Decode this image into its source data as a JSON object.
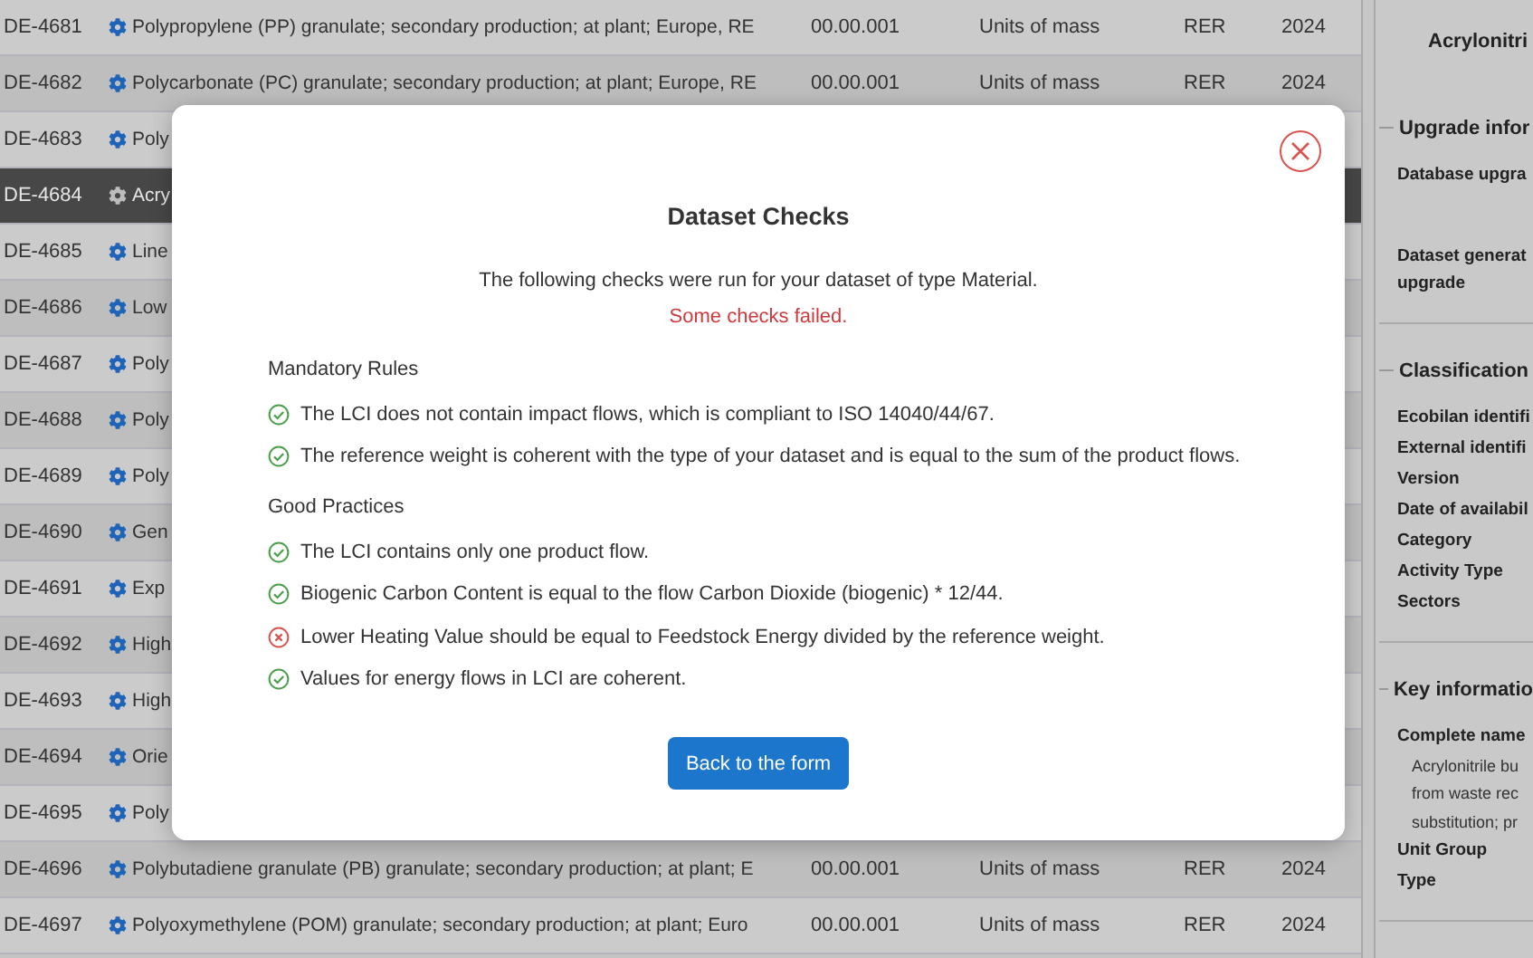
{
  "table": {
    "rows": [
      {
        "id": "DE-4681",
        "name": "Polypropylene (PP) granulate; secondary production; at plant; Europe, RE",
        "version": "00.00.001",
        "unit": "Units of mass",
        "location": "RER",
        "year": "2024",
        "selected": false
      },
      {
        "id": "DE-4682",
        "name": "Polycarbonate (PC) granulate; secondary production; at plant; Europe, RE",
        "version": "00.00.001",
        "unit": "Units of mass",
        "location": "RER",
        "year": "2024",
        "selected": false
      },
      {
        "id": "DE-4683",
        "name": "Poly",
        "selected": false
      },
      {
        "id": "DE-4684",
        "name": "Acry",
        "selected": true
      },
      {
        "id": "DE-4685",
        "name": "Line",
        "selected": false
      },
      {
        "id": "DE-4686",
        "name": "Low",
        "selected": false
      },
      {
        "id": "DE-4687",
        "name": "Poly",
        "selected": false
      },
      {
        "id": "DE-4688",
        "name": "Poly",
        "selected": false
      },
      {
        "id": "DE-4689",
        "name": "Poly",
        "selected": false
      },
      {
        "id": "DE-4690",
        "name": "Gen",
        "selected": false
      },
      {
        "id": "DE-4691",
        "name": "Exp",
        "selected": false
      },
      {
        "id": "DE-4692",
        "name": "High",
        "selected": false
      },
      {
        "id": "DE-4693",
        "name": "High",
        "selected": false
      },
      {
        "id": "DE-4694",
        "name": "Orie",
        "selected": false
      },
      {
        "id": "DE-4695",
        "name": "Poly",
        "selected": false
      },
      {
        "id": "DE-4696",
        "name": "Polybutadiene granulate (PB) granulate; secondary production; at plant; E",
        "version": "00.00.001",
        "unit": "Units of mass",
        "location": "RER",
        "year": "2024",
        "selected": false
      },
      {
        "id": "DE-4697",
        "name": "Polyoxymethylene (POM) granulate; secondary production; at plant; Euro",
        "version": "00.00.001",
        "unit": "Units of mass",
        "location": "RER",
        "year": "2024",
        "selected": false
      }
    ]
  },
  "detail_panel": {
    "title": "Acrylonitri",
    "sections": [
      {
        "legend": "Upgrade infor",
        "fields": [
          {
            "label": [
              "Database upgra"
            ]
          },
          {
            "label": [
              "Dataset generat",
              "upgrade"
            ]
          }
        ]
      },
      {
        "legend": "Classification",
        "fields": [
          {
            "label": [
              "Ecobilan identifi"
            ]
          },
          {
            "label": [
              "External identifi"
            ]
          },
          {
            "label": [
              "Version"
            ]
          },
          {
            "label": [
              "Date of availabil"
            ]
          },
          {
            "label": [
              "Category"
            ]
          },
          {
            "label": [
              "Activity Type"
            ]
          },
          {
            "label": [
              "Sectors"
            ]
          }
        ]
      },
      {
        "legend": "Key informatio",
        "fields": [
          {
            "label": [
              "Complete name"
            ],
            "value": [
              "Acrylonitrile bu",
              "from waste rec",
              "substitution; pr"
            ]
          },
          {
            "label": [
              "Unit Group"
            ]
          },
          {
            "label": [
              "Type"
            ]
          }
        ]
      }
    ]
  },
  "dialog": {
    "title": "Dataset Checks",
    "intro": "The following checks were run for your dataset of type Material.",
    "status": "Some checks failed.",
    "groups": [
      {
        "heading": "Mandatory Rules",
        "checks": [
          {
            "text": "The LCI does not contain impact flows, which is compliant to ISO 14040/44/67.",
            "passed": true
          },
          {
            "text": "The reference weight is coherent with the type of your dataset and is equal to the sum of the product flows.",
            "passed": true
          }
        ]
      },
      {
        "heading": "Good Practices",
        "checks": [
          {
            "text": "The LCI contains only one product flow.",
            "passed": true
          },
          {
            "text": "Biogenic Carbon Content is equal to the flow Carbon Dioxide (biogenic) * 12/44.",
            "passed": true
          },
          {
            "text": "Lower Heating Value should be equal to Feedstock Energy divided by the reference weight.",
            "passed": false
          },
          {
            "text": "Values for energy flows in LCI are coherent.",
            "passed": true
          }
        ]
      }
    ],
    "button": "Back to the form"
  }
}
